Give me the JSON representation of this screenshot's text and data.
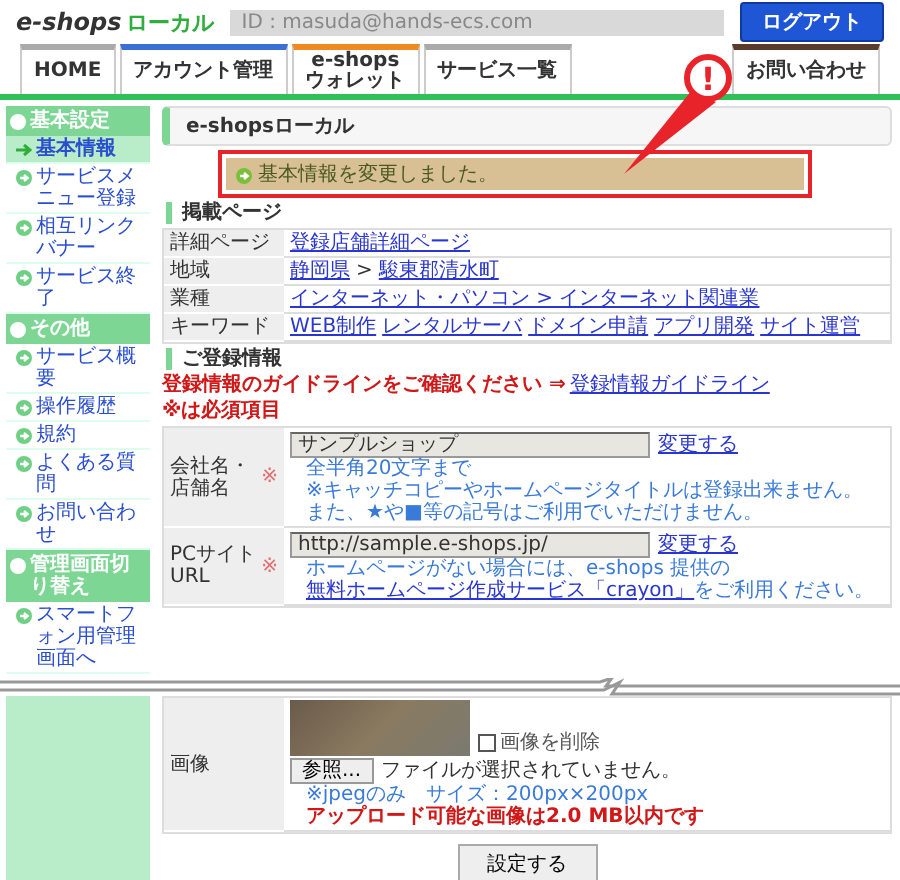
{
  "header": {
    "logo_main": "e-shops",
    "logo_sub": "ローカル",
    "id_field": "ID : masuda@hands-ecs.com",
    "logout": "ログアウト"
  },
  "tabs": [
    {
      "lines": [
        "HOME"
      ],
      "color": "#aaaaaa"
    },
    {
      "lines": [
        "アカウント管理"
      ],
      "color": "#3b6fd6"
    },
    {
      "lines": [
        "e-shops",
        "ウォレット"
      ],
      "color": "#f08a1e"
    },
    {
      "lines": [
        "サービス一覧"
      ],
      "color": "#aaaaaa"
    }
  ],
  "contact_tab": {
    "lines": [
      "お問い合わせ"
    ],
    "color": "#5a3a2a"
  },
  "sidebar": [
    {
      "kind": "heading",
      "label": "基本設定"
    },
    {
      "kind": "link",
      "label": "基本情報",
      "selected": true
    },
    {
      "kind": "link",
      "label": "サービスメニュー登録",
      "selected": false
    },
    {
      "kind": "link",
      "label": "相互リンクバナー",
      "selected": false
    },
    {
      "kind": "link",
      "label": "サービス終了",
      "selected": false
    },
    {
      "kind": "heading",
      "label": "その他"
    },
    {
      "kind": "link",
      "label": "サービス概要",
      "selected": false
    },
    {
      "kind": "link",
      "label": "操作履歴",
      "selected": false
    },
    {
      "kind": "link",
      "label": "規約",
      "selected": false
    },
    {
      "kind": "link",
      "label": "よくある質問",
      "selected": false
    },
    {
      "kind": "link",
      "label": "お問い合わせ",
      "selected": false
    },
    {
      "kind": "heading",
      "label": "管理画面切り替え"
    },
    {
      "kind": "link",
      "label": "スマートフォン用管理画面へ",
      "selected": false
    }
  ],
  "page_title": "e-shopsローカル",
  "message": "基本情報を変更しました。",
  "callout": "!",
  "listing": {
    "heading": "掲載ページ",
    "rows": [
      {
        "label": "詳細ページ",
        "parts": [
          {
            "text": "登録店舗詳細ページ",
            "link": true
          }
        ]
      },
      {
        "label": "地域",
        "parts": [
          {
            "text": "静岡県",
            "link": true
          },
          {
            "text": ">",
            "link": false
          },
          {
            "text": "駿東郡清水町",
            "link": true
          }
        ]
      },
      {
        "label": "業種",
        "parts": [
          {
            "text": "インターネット・パソコン > インターネット関連業",
            "link": true
          }
        ]
      },
      {
        "label": "キーワード",
        "parts": [
          {
            "text": "WEB制作",
            "link": true
          },
          {
            "text": "レンタルサーバ",
            "link": true
          },
          {
            "text": "ドメイン申請",
            "link": true
          },
          {
            "text": "アプリ開発",
            "link": true
          },
          {
            "text": "サイト運営",
            "link": true
          }
        ]
      }
    ]
  },
  "registration": {
    "heading": "ご登録情報",
    "guide_text": "登録情報のガイドラインをご確認ください ⇒",
    "guide_link": "登録情報ガイドライン",
    "required_note": "※は必須項目",
    "fields": [
      {
        "label": "会社名・店舗名",
        "mark": "※",
        "value": "サンプルショップ",
        "action": "変更する",
        "notes": [
          "全半角20文字まで",
          "※キャッチコピーやホームページタイトルは登録出来ません。",
          "また、★や■等の記号はご利用でいただけません。"
        ]
      },
      {
        "label": "PCサイトURL",
        "mark": "※",
        "value": "http://sample.e-shops.jp/",
        "action": "変更する",
        "notes": [
          "ホームページがない場合には、e-shops 提供の"
        ],
        "note_link": "無料ホームページ作成サービス「crayon」",
        "note_after": "をご利用ください。"
      }
    ]
  },
  "image_field": {
    "label": "画像",
    "delete": {
      "label": "画像を削除",
      "checked": false
    },
    "browse": "参照...",
    "file_status": "ファイルが選択されていません。",
    "notes": [
      {
        "kind": "info",
        "text": "※jpegのみ　サイズ：200px×200px"
      },
      {
        "kind": "warning",
        "text": "アップロード可能な画像は2.0 MB以内です"
      }
    ]
  },
  "submit": "設定する"
}
